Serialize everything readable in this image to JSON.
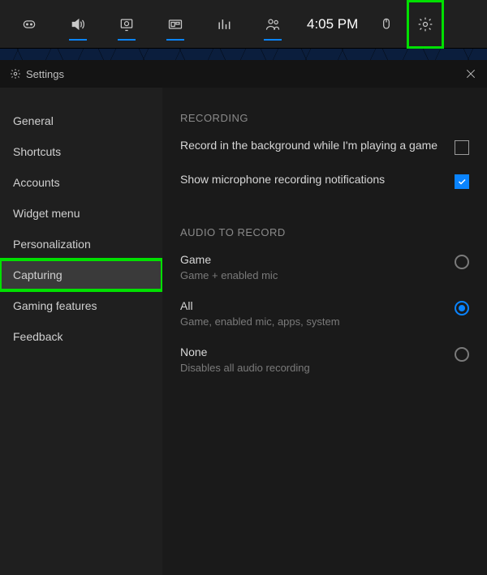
{
  "topbar": {
    "time": "4:05 PM"
  },
  "settings": {
    "title": "Settings"
  },
  "sidebar": {
    "items": [
      {
        "label": "General"
      },
      {
        "label": "Shortcuts"
      },
      {
        "label": "Accounts"
      },
      {
        "label": "Widget menu"
      },
      {
        "label": "Personalization"
      },
      {
        "label": "Capturing"
      },
      {
        "label": "Gaming features"
      },
      {
        "label": "Feedback"
      }
    ],
    "selectedIndex": 5
  },
  "content": {
    "recordingHead": "RECORDING",
    "bgRecord": {
      "label": "Record in the background while I'm playing a game",
      "checked": false
    },
    "micNotif": {
      "label": "Show microphone recording notifications",
      "checked": true
    },
    "audioHead": "AUDIO TO RECORD",
    "radios": [
      {
        "title": "Game",
        "sub": "Game + enabled mic",
        "selected": false
      },
      {
        "title": "All",
        "sub": "Game, enabled mic, apps, system",
        "selected": true
      },
      {
        "title": "None",
        "sub": "Disables all audio recording",
        "selected": false
      }
    ]
  }
}
